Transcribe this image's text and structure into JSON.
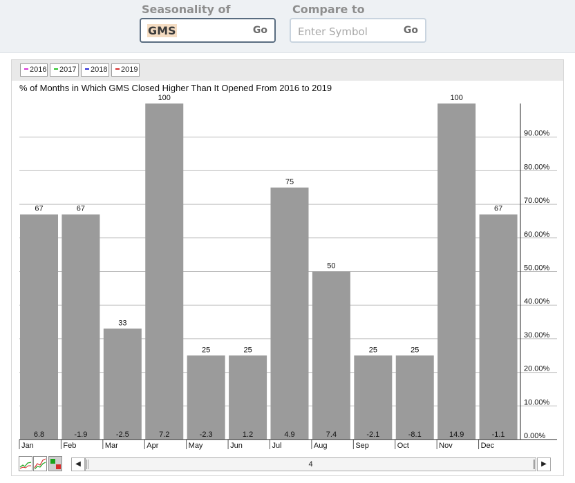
{
  "search": {
    "seasonality_label": "Seasonality of",
    "symbol_value": "GMS",
    "go_label": "Go",
    "compare_label": "Compare to",
    "compare_placeholder": "Enter Symbol",
    "compare_go_label": "Go"
  },
  "legend": [
    {
      "label": "2016",
      "color": "#d633d6"
    },
    {
      "label": "2017",
      "color": "#27c227"
    },
    {
      "label": "2018",
      "color": "#2b2bd6"
    },
    {
      "label": "2019",
      "color": "#d62b2b"
    }
  ],
  "scrollbar": {
    "position_label": "4"
  },
  "chart_data": {
    "type": "bar",
    "title": "% of Months in Which GMS Closed Higher Than It Opened From 2016 to 2019",
    "categories": [
      "Jan",
      "Feb",
      "Mar",
      "Apr",
      "May",
      "Jun",
      "Jul",
      "Aug",
      "Sep",
      "Oct",
      "Nov",
      "Dec"
    ],
    "series": [
      {
        "values": [
          67,
          67,
          33,
          100,
          25,
          25,
          75,
          50,
          25,
          25,
          100,
          67
        ]
      }
    ],
    "bottom_labels": [
      "6.8",
      "-1.9",
      "-2.5",
      "7.2",
      "-2.3",
      "1.2",
      "4.9",
      "7.4",
      "-2.1",
      "-8.1",
      "14.9",
      "-1.1"
    ],
    "ylim": [
      0,
      100
    ],
    "y_ticks": [
      "0.00%",
      "10.00%",
      "20.00%",
      "30.00%",
      "40.00%",
      "50.00%",
      "60.00%",
      "70.00%",
      "80.00%",
      "90.00%"
    ],
    "y_axis_side": "right",
    "grid": true,
    "bar_color": "#9b9b9b"
  }
}
